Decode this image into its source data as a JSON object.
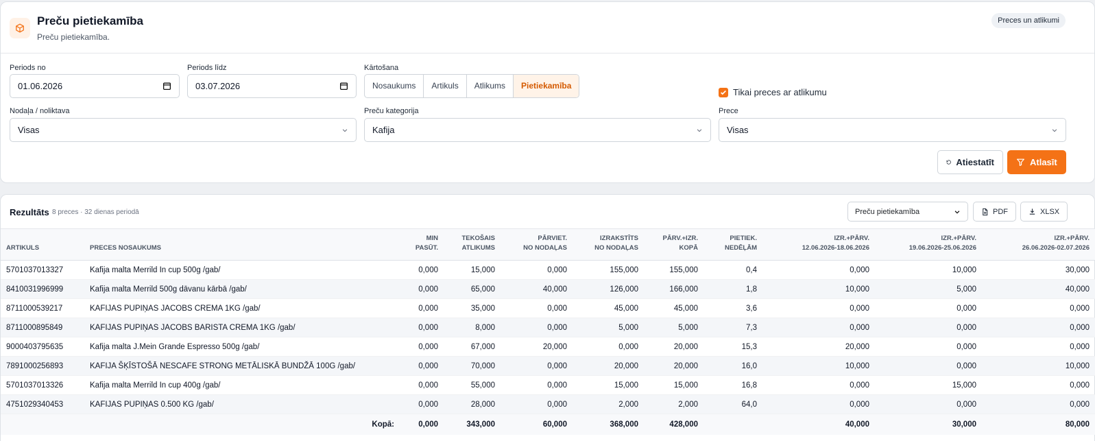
{
  "header": {
    "title": "Preču pietiekamība",
    "subtitle": "Preču pietiekamība.",
    "badge": "Preces un atlikumi",
    "icon": "box-icon"
  },
  "filters": {
    "period_from_label": "Periods no",
    "period_from_value": "01.06.2026",
    "period_to_label": "Periods līdz",
    "period_to_value": "03.07.2026",
    "sort_label": "Kārtošana",
    "sort_options": [
      "Nosaukums",
      "Artikuls",
      "Atlikums",
      "Pietiekamība"
    ],
    "sort_active": "Pietiekamība",
    "only_stock_label": "Tikai preces ar atlikumu",
    "only_stock_checked": true,
    "department_label": "Nodaļa / noliktava",
    "department_value": "Visas",
    "category_label": "Preču kategorija",
    "category_value": "Kafija",
    "product_label": "Prece",
    "product_value": "Visas",
    "reset_label": "Atiestatīt",
    "apply_label": "Atlasīt"
  },
  "results": {
    "title": "Rezultāts",
    "meta": "8 preces · 32 dienas periodā",
    "report_select": "Preču pietiekamība",
    "pdf_label": "PDF",
    "xlsx_label": "XLSX",
    "columns": [
      {
        "l1": "",
        "l2": "ARTIKULS"
      },
      {
        "l1": "",
        "l2": "PRECES NOSAUKUMS"
      },
      {
        "l1": "MIN",
        "l2": "PASŪT."
      },
      {
        "l1": "TEKOŠAIS",
        "l2": "ATLIKUMS"
      },
      {
        "l1": "PĀRVIET.",
        "l2": "NO NODAĻAS"
      },
      {
        "l1": "IZRAKSTĪTS",
        "l2": "NO NODAĻAS"
      },
      {
        "l1": "PĀRV.+IZR.",
        "l2": "KOPĀ"
      },
      {
        "l1": "PIETIEK.",
        "l2": "NEDĒĻĀM"
      },
      {
        "l1": "IZR.+PĀRV.",
        "l2": "12.06.2026-18.06.2026"
      },
      {
        "l1": "IZR.+PĀRV.",
        "l2": "19.06.2026-25.06.2026"
      },
      {
        "l1": "IZR.+PĀRV.",
        "l2": "26.06.2026-02.07.2026"
      }
    ],
    "rows": [
      [
        "5701037013327",
        "Kafija malta Merrild In cup 500g /gab/",
        "0,000",
        "15,000",
        "0,000",
        "155,000",
        "155,000",
        "0,4",
        "0,000",
        "10,000",
        "30,000"
      ],
      [
        "8410031996999",
        "Kafija malta Merrild 500g dāvanu kārbā /gab/",
        "0,000",
        "65,000",
        "40,000",
        "126,000",
        "166,000",
        "1,8",
        "10,000",
        "5,000",
        "40,000"
      ],
      [
        "8711000539217",
        "KAFIJAS PUPIŅAS JACOBS CREMA 1KG /gab/",
        "0,000",
        "35,000",
        "0,000",
        "45,000",
        "45,000",
        "3,6",
        "0,000",
        "0,000",
        "0,000"
      ],
      [
        "8711000895849",
        "KAFIJAS PUPIŅAS JACOBS BARISTA CREMA 1KG /gab/",
        "0,000",
        "8,000",
        "0,000",
        "5,000",
        "5,000",
        "7,3",
        "0,000",
        "0,000",
        "0,000"
      ],
      [
        "9000403795635",
        "Kafija malta J.Mein Grande Espresso 500g /gab/",
        "0,000",
        "67,000",
        "20,000",
        "0,000",
        "20,000",
        "15,3",
        "20,000",
        "0,000",
        "0,000"
      ],
      [
        "7891000256893",
        "KAFIJA ŠĶĪSTOŠĀ NESCAFE STRONG METĀLISKĀ BUNDŽĀ 100G /gab/",
        "0,000",
        "70,000",
        "0,000",
        "20,000",
        "20,000",
        "16,0",
        "10,000",
        "0,000",
        "10,000"
      ],
      [
        "5701037013326",
        "Kafija malta Merrild In cup 400g /gab/",
        "0,000",
        "55,000",
        "0,000",
        "15,000",
        "15,000",
        "16,8",
        "0,000",
        "15,000",
        "0,000"
      ],
      [
        "4751029340453",
        "KAFIJAS PUPIŅAS 0.500 KG /gab/",
        "0,000",
        "28,000",
        "0,000",
        "2,000",
        "2,000",
        "64,0",
        "0,000",
        "0,000",
        "0,000"
      ]
    ],
    "totals_label": "Kopā:",
    "totals": [
      "0,000",
      "343,000",
      "60,000",
      "368,000",
      "428,000",
      "",
      "40,000",
      "30,000",
      "80,000"
    ]
  },
  "colors": {
    "accent": "#f47216",
    "accent_light": "#fff3e8"
  }
}
